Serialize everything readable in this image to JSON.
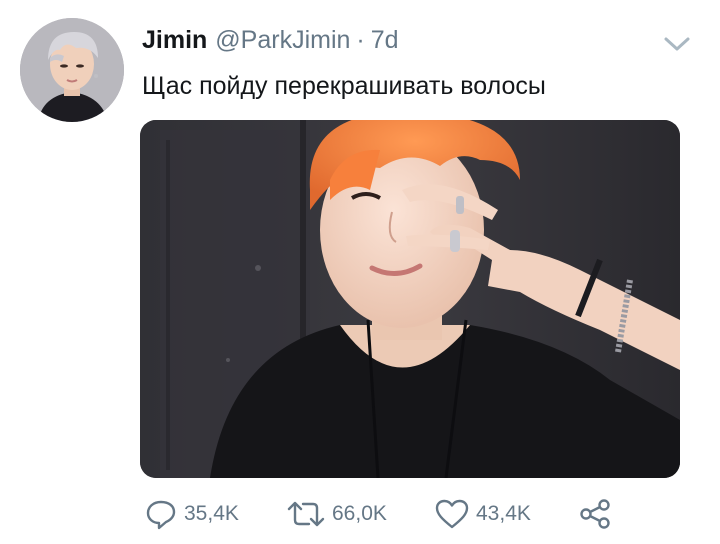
{
  "tweet": {
    "author": {
      "name": "Jimin",
      "handle": "@ParkJimin",
      "separator": "·",
      "time": "7d"
    },
    "text": "Щас пойду перекрашивать волосы",
    "actions": {
      "replies": "35,4K",
      "retweets": "66,0K",
      "likes": "43,4K"
    },
    "icons": {
      "menu": "chevron-down-icon",
      "reply": "reply-icon",
      "retweet": "retweet-icon",
      "like": "heart-icon",
      "share": "share-icon"
    },
    "colors": {
      "text": "#14171a",
      "secondary": "#657786",
      "hair": "#f3884a"
    }
  }
}
